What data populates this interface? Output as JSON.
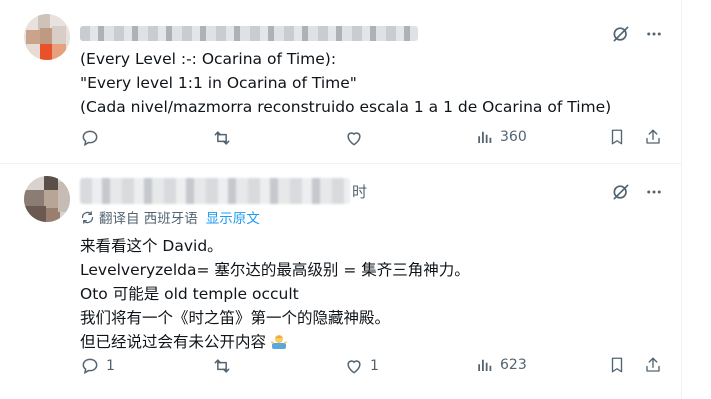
{
  "posts": [
    {
      "lines": [
        "(Every Level :-: Ocarina of Time):",
        "\"Every level 1:1 in Ocarina of Time\"",
        "(Cada nivel/mazmorra reconstruido escala 1 a 1 de Ocarina of Time)"
      ],
      "actions": {
        "reply": "",
        "repost": "",
        "like": "",
        "views": "360"
      }
    },
    {
      "time": "时",
      "translated_label": "翻译自 西班牙语",
      "show_original": "显示原文",
      "lines": [
        "来看看这个 David。",
        "Levelveryzelda= 塞尔达的最高级别 = 集齐三角神力。",
        "Oto 可能是 old temple occult",
        "我们将有一个《时之笛》第一个的隐藏神殿。",
        "但已经说过会有未公开内容"
      ],
      "actions": {
        "reply": "1",
        "repost": "",
        "like": "1",
        "views": "623"
      }
    }
  ],
  "icons": {
    "grok": "grok-icon",
    "more": "more-icon",
    "reply": "reply-icon",
    "repost": "repost-icon",
    "like": "like-icon",
    "views": "views-icon",
    "bookmark": "bookmark-icon",
    "share": "share-icon",
    "translate": "translate-icon",
    "emoji": "person-shrugging-emoji"
  },
  "colors": {
    "text": "#0f1419",
    "muted": "#536471",
    "link": "#1d9bf0",
    "divider": "#eff3f4"
  }
}
